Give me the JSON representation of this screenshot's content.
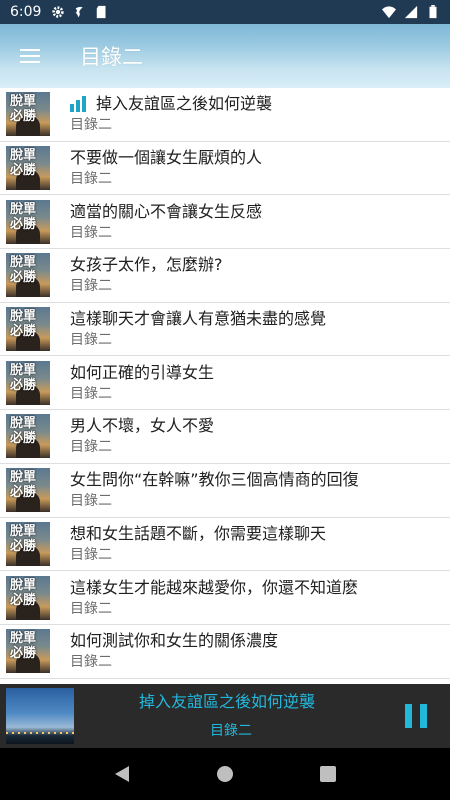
{
  "status_bar": {
    "time": "6:09",
    "left_icons": [
      "gear-icon",
      "fan-icon",
      "sd-card-icon"
    ],
    "right_icons": [
      "wifi-icon",
      "signal-icon",
      "battery-icon"
    ]
  },
  "app_bar": {
    "title": "目錄二",
    "menu_icon": "hamburger-menu-icon"
  },
  "list": {
    "items": [
      {
        "title": "掉入友誼區之後如何逆襲",
        "subtitle": "目錄二",
        "playing": true,
        "thumb_text": "脫單\n必勝"
      },
      {
        "title": "不要做一個讓女生厭煩的人",
        "subtitle": "目錄二",
        "playing": false,
        "thumb_text": "脫單\n必勝"
      },
      {
        "title": "適當的關心不會讓女生反感",
        "subtitle": "目錄二",
        "playing": false,
        "thumb_text": "脫單\n必勝"
      },
      {
        "title": "女孩子太作，怎麼辦?",
        "subtitle": "目錄二",
        "playing": false,
        "thumb_text": "脫單\n必勝"
      },
      {
        "title": "這樣聊天才會讓人有意猶未盡的感覺",
        "subtitle": "目錄二",
        "playing": false,
        "thumb_text": "脫單\n必勝"
      },
      {
        "title": "如何正確的引導女生",
        "subtitle": "目錄二",
        "playing": false,
        "thumb_text": "脫單\n必勝"
      },
      {
        "title": "男人不壞，女人不愛",
        "subtitle": "目錄二",
        "playing": false,
        "thumb_text": "脫單\n必勝"
      },
      {
        "title": "女生問你“在幹嘛”教你三個高情商的回復",
        "subtitle": "目錄二",
        "playing": false,
        "thumb_text": "脫單\n必勝"
      },
      {
        "title": "想和女生話題不斷，你需要這樣聊天",
        "subtitle": "目錄二",
        "playing": false,
        "thumb_text": "脫單\n必勝"
      },
      {
        "title": "這樣女生才能越來越愛你，你還不知道麽",
        "subtitle": "目錄二",
        "playing": false,
        "thumb_text": "脫單\n必勝"
      },
      {
        "title": "如何測試你和女生的關係濃度",
        "subtitle": "目錄二",
        "playing": false,
        "thumb_text": "脫單\n必勝"
      }
    ]
  },
  "player": {
    "title": "掉入友誼區之後如何逆襲",
    "subtitle": "目錄二",
    "pause_icon": "pause-icon",
    "accent_color": "#22b8dc"
  },
  "nav_bar": {
    "icons": [
      "back-icon",
      "home-icon",
      "recents-icon"
    ]
  }
}
